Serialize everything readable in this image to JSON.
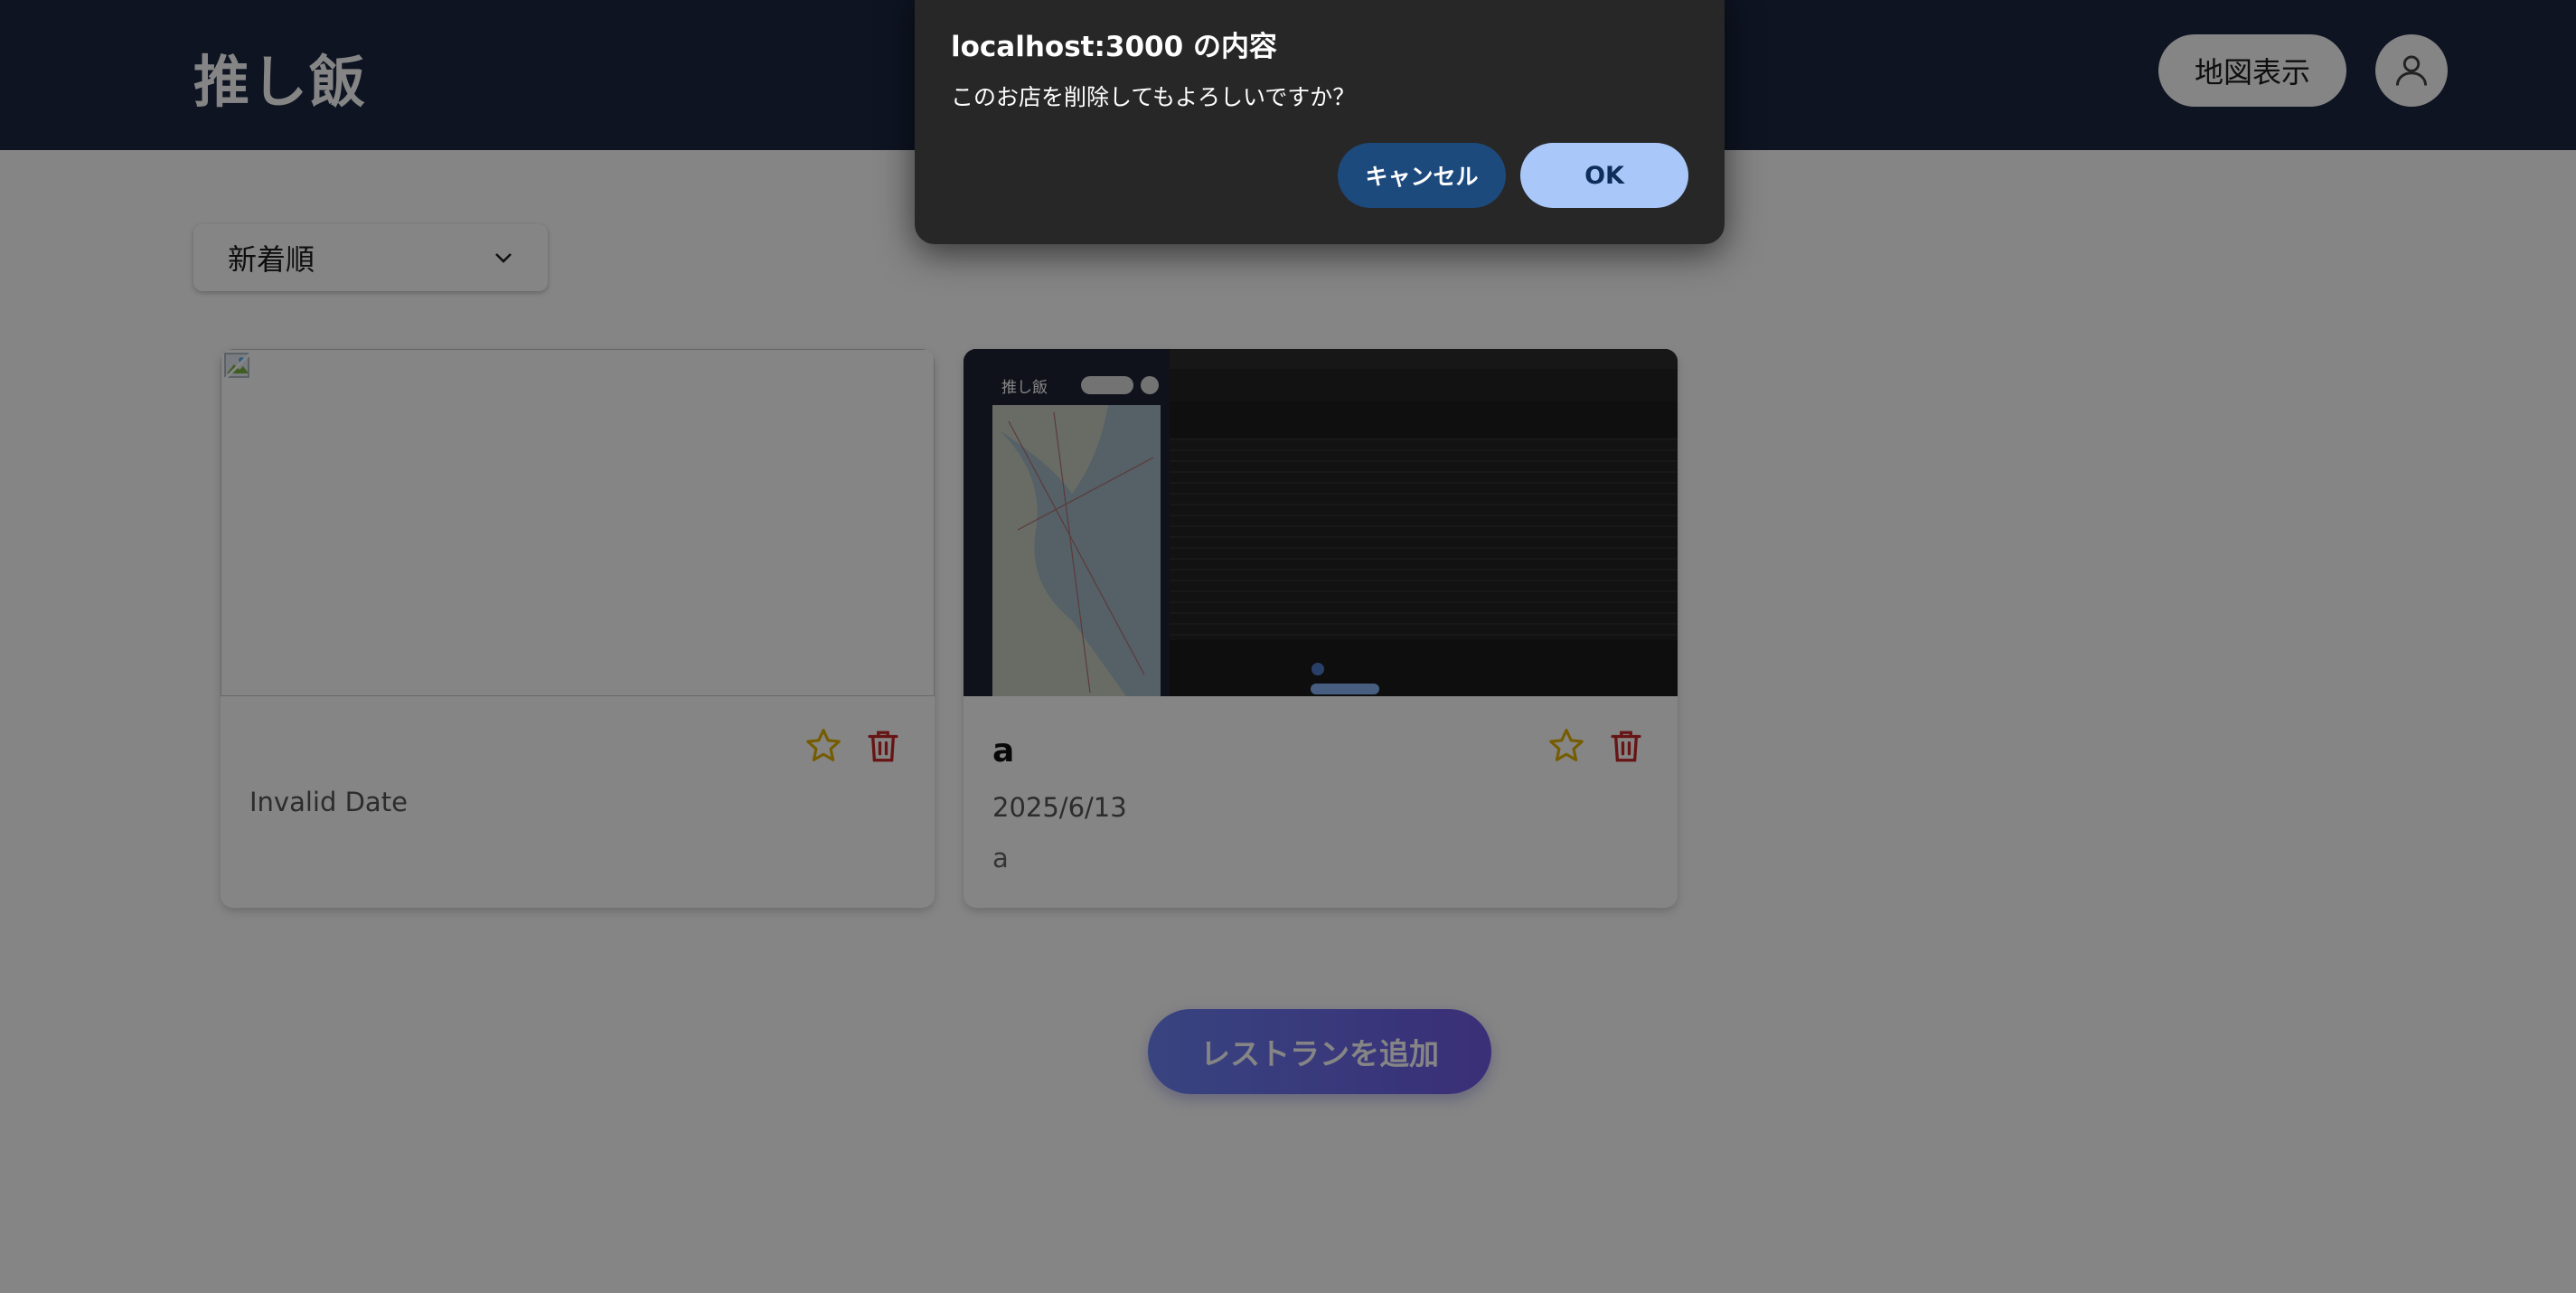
{
  "header": {
    "app_title": "推し飯",
    "map_button_label": "地図表示",
    "avatar_icon": "user-icon"
  },
  "sort": {
    "selected": "新着順"
  },
  "cards": [
    {
      "name": "",
      "date": "Invalid Date",
      "description": "",
      "favorite_icon": "star-outline-icon",
      "delete_icon": "trash-icon",
      "image": "broken-image"
    },
    {
      "name": "a",
      "date": "2025/6/13",
      "description": "a",
      "favorite_icon": "star-outline-icon",
      "delete_icon": "trash-icon",
      "image": "screenshot-thumbnail"
    }
  ],
  "add_button_label": "レストランを追加",
  "dialog": {
    "title": "localhost:3000 の内容",
    "message": "このお店を削除してもよろしいですか？",
    "cancel_label": "キャンセル",
    "ok_label": "OK"
  },
  "colors": {
    "header_bg": "#1c2741",
    "star": "#e3b100",
    "trash": "#c62828",
    "add_button_gradient": [
      "#6b82f5",
      "#6f5be6"
    ],
    "dialog_bg": "#272727",
    "cancel_bg": "#1d4a7d",
    "ok_bg": "#a9c7f9"
  }
}
